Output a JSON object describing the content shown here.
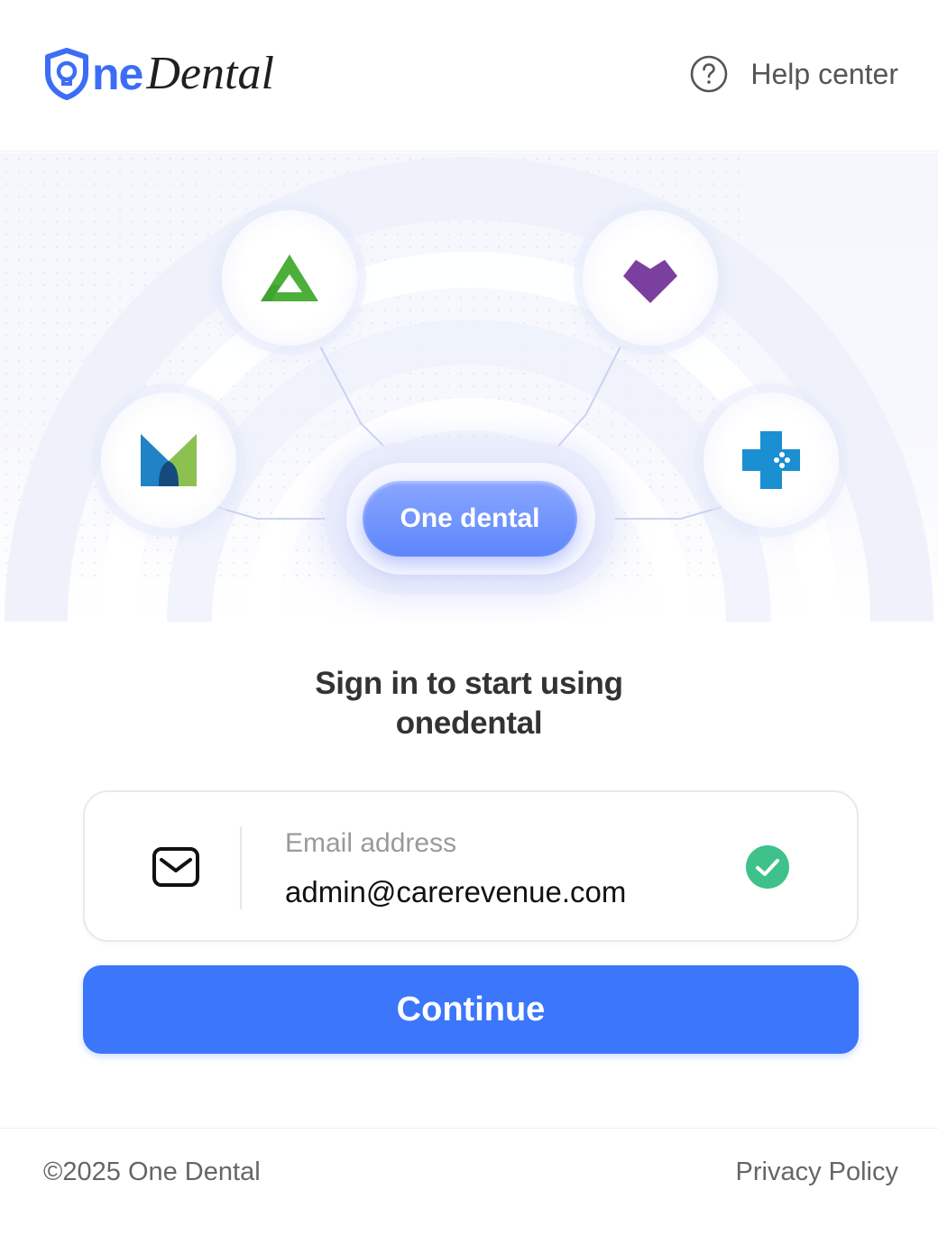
{
  "header": {
    "logo": {
      "prefix": "ne",
      "suffix": "Dental",
      "brand_color": "#3d6df6"
    },
    "help": {
      "label": "Help center",
      "icon": "question-circle-icon"
    }
  },
  "hero": {
    "center_pill_label": "One dental",
    "integrations": [
      {
        "name": "green-triangle-logo",
        "color": "#4caf3a"
      },
      {
        "name": "purple-heart-logo",
        "color": "#7b3fa0"
      },
      {
        "name": "m-logo",
        "colors": [
          "#1f83c6",
          "#8cc152",
          "#174a7c"
        ]
      },
      {
        "name": "blue-cross-logo",
        "color": "#1a8fd1"
      }
    ]
  },
  "signin": {
    "title_line1": "Sign in to start using",
    "title_line2": "onedental",
    "email": {
      "label": "Email address",
      "value": "admin@carerevenue.com",
      "icon": "mail-icon",
      "status_icon": "check-circle-icon",
      "status_color": "#3ec28a"
    },
    "continue_label": "Continue",
    "accent_color": "#3b76fb"
  },
  "footer": {
    "copyright": "©2025 One Dental",
    "privacy_label": "Privacy Policy"
  }
}
